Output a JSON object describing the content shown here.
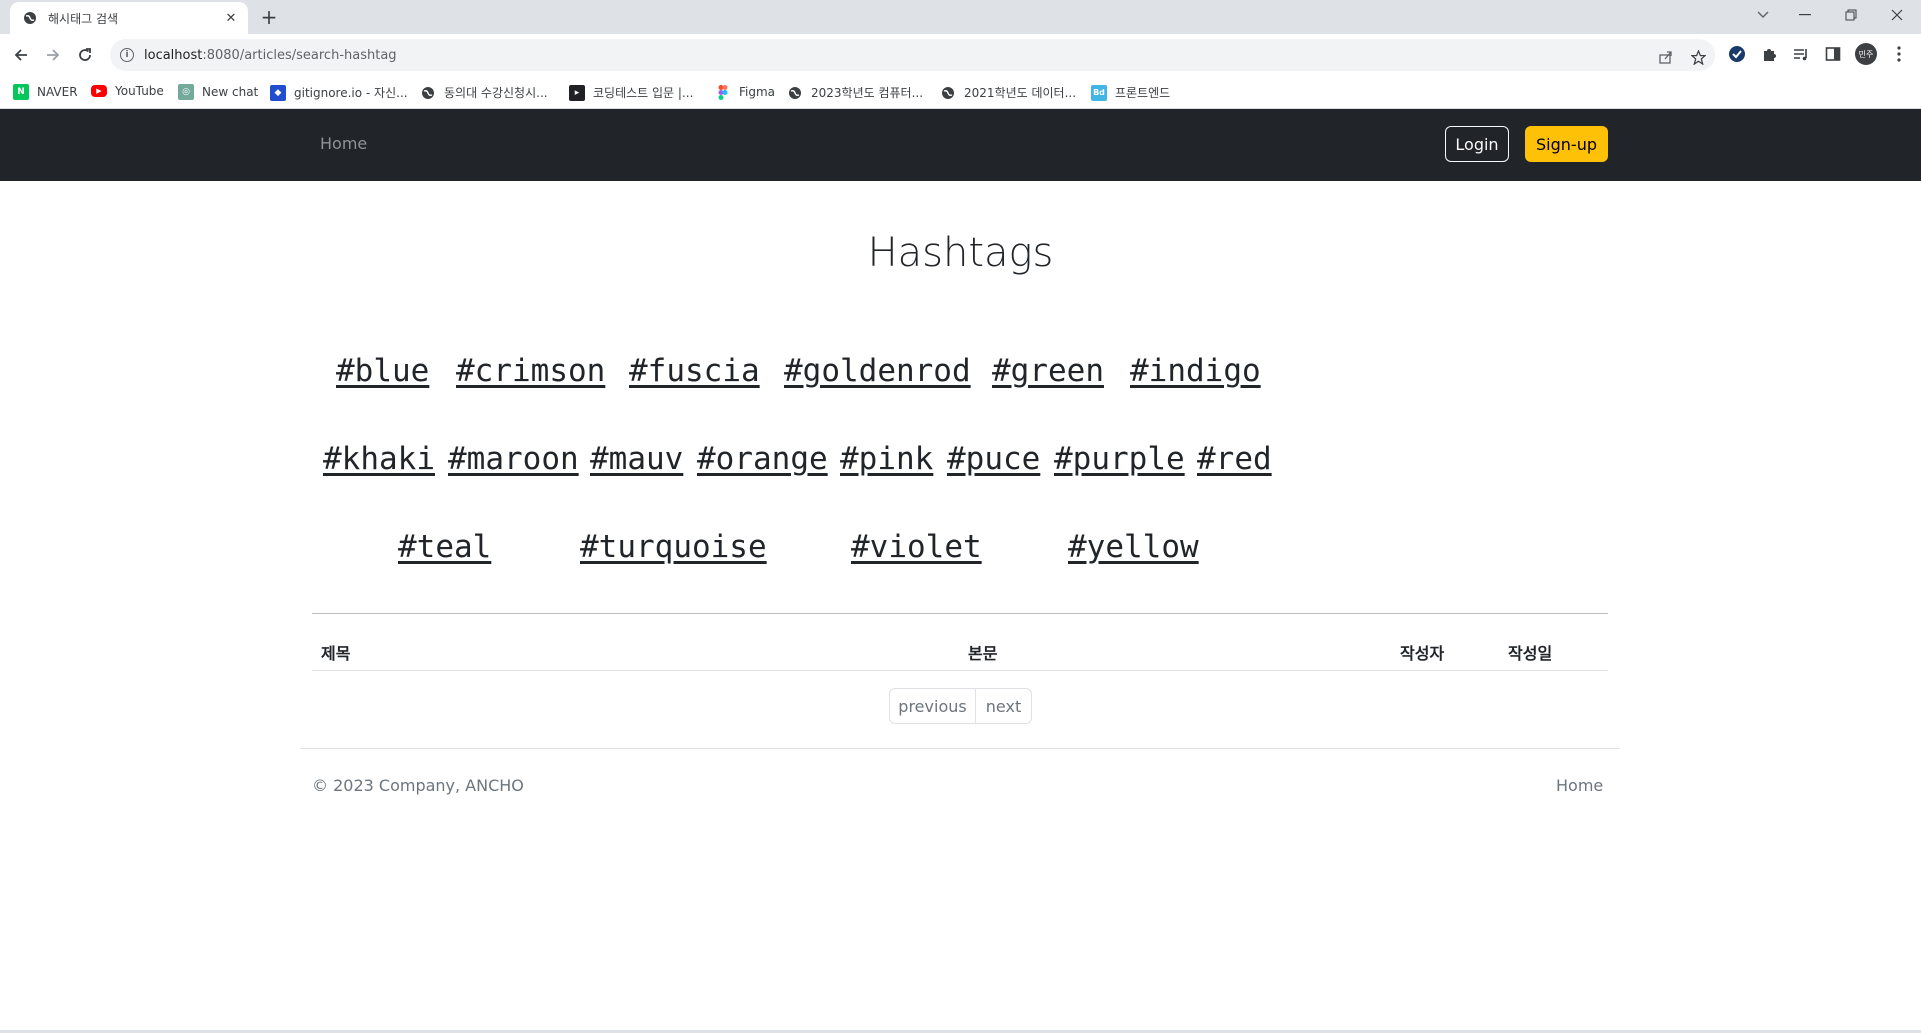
{
  "browser": {
    "tab_title": "해시태그 검색",
    "new_tab_symbol": "+",
    "close_symbol": "✕",
    "url_host": "localhost",
    "url_path": ":8080/articles/search-hashtag",
    "bookmarks": [
      {
        "label": "NAVER",
        "icon": "naver-icon",
        "color": "#03c75a",
        "glyph": "N"
      },
      {
        "label": "YouTube",
        "icon": "youtube-icon",
        "color": "#ff0000",
        "glyph": "▶"
      },
      {
        "label": "New chat",
        "icon": "chatgpt-icon",
        "color": "#74aa9c",
        "glyph": "◎"
      },
      {
        "label": "gitignore.io - 자신...",
        "icon": "gitignore-icon",
        "color": "#204ecf",
        "glyph": "◆"
      },
      {
        "label": "동의대 수강신청시...",
        "icon": "globe-icon",
        "color": "#5f6368",
        "glyph": ""
      },
      {
        "label": "코딩테스트 입문 |...",
        "icon": "programmers-icon",
        "color": "#202124",
        "glyph": "▸"
      },
      {
        "label": "Figma",
        "icon": "figma-icon",
        "color": "#f24e1e",
        "glyph": ""
      },
      {
        "label": "2023학년도 컴퓨터...",
        "icon": "globe-icon",
        "color": "#5f6368",
        "glyph": ""
      },
      {
        "label": "2021학년도 데이터...",
        "icon": "globe-icon",
        "color": "#5f6368",
        "glyph": ""
      },
      {
        "label": "프론트엔드",
        "icon": "bd-icon",
        "color": "#41b6e6",
        "glyph": "Bd"
      }
    ],
    "profile_initials": "민주"
  },
  "navbar": {
    "home_label": "Home",
    "login_label": "Login",
    "signup_label": "Sign-up"
  },
  "main": {
    "title": "Hashtags",
    "hashtag_rows": [
      [
        "#blue",
        "#crimson",
        "#fuscia",
        "#goldenrod",
        "#green",
        "#indigo"
      ],
      [
        "#khaki",
        "#maroon",
        "#mauv",
        "#orange",
        "#pink",
        "#puce",
        "#purple",
        "#red"
      ],
      [
        "#teal",
        "#turquoise",
        "#violet",
        "#yellow"
      ]
    ],
    "table_headers": {
      "title": "제목",
      "content": "본문",
      "author": "작성자",
      "created": "작성일"
    },
    "pagination": {
      "previous": "previous",
      "next": "next"
    }
  },
  "footer": {
    "copyright": "© 2023 Company, ANCHO",
    "home_label": "Home"
  },
  "colors": {
    "navbar_bg": "#212529",
    "signup_bg": "#ffc107",
    "text": "#212529",
    "muted": "#6c757d"
  }
}
